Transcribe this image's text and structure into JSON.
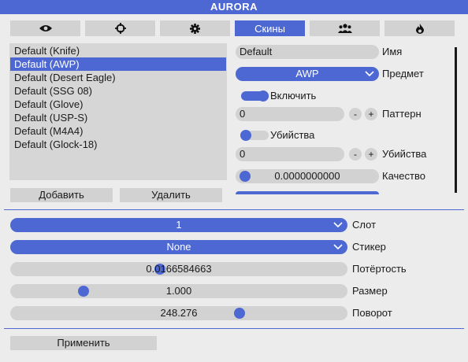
{
  "window": {
    "title": "AURORA"
  },
  "tabs": [
    {
      "icon": "eye-icon",
      "label": ""
    },
    {
      "icon": "crosshair-icon",
      "label": ""
    },
    {
      "icon": "gear-icon",
      "label": ""
    },
    {
      "icon": "",
      "label": "Скины"
    },
    {
      "icon": "users-icon",
      "label": ""
    },
    {
      "icon": "flame-icon",
      "label": ""
    }
  ],
  "active_tab": 3,
  "colors": {
    "accent": "#4d68d3",
    "panel": "#d2d2d2",
    "background": "#ececec"
  },
  "skins_list": {
    "items": [
      "Default (Knife)",
      "Default (AWP)",
      "Default (Desert Eagle)",
      "Default (SSG 08)",
      "Default (Glove)",
      "Default (USP-S)",
      "Default (M4A4)",
      "Default (Glock-18)"
    ],
    "selected_index": 1,
    "add_label": "Добавить",
    "remove_label": "Удалить"
  },
  "skin_settings": {
    "name_value": "Default",
    "name_label": "Имя",
    "item_value": "AWP",
    "item_label": "Предмет",
    "enable_label": "Включить",
    "enable_on": true,
    "pattern_value": "0",
    "minus_label": "-",
    "plus_label": "+",
    "pattern_label": "Паттерн",
    "stattrak_label": "Убийства",
    "stattrak_on": false,
    "kills_value": "0",
    "kills_label": "Убийства",
    "quality_value": "0.0000000000",
    "quality_label": "Качество",
    "quality_fraction": 0
  },
  "sticker_settings": {
    "slot_value": "1",
    "slot_label": "Слот",
    "sticker_value": "None",
    "sticker_label": "Стикер",
    "wear_value": "0.0166584663",
    "wear_label": "Потёртость",
    "wear_fraction": 0.44,
    "scale_value": "1.000",
    "scale_label": "Размер",
    "scale_fraction": 0.2,
    "rotation_value": "248.276",
    "rotation_label": "Поворот",
    "rotation_fraction": 0.69
  },
  "apply_label": "Применить"
}
